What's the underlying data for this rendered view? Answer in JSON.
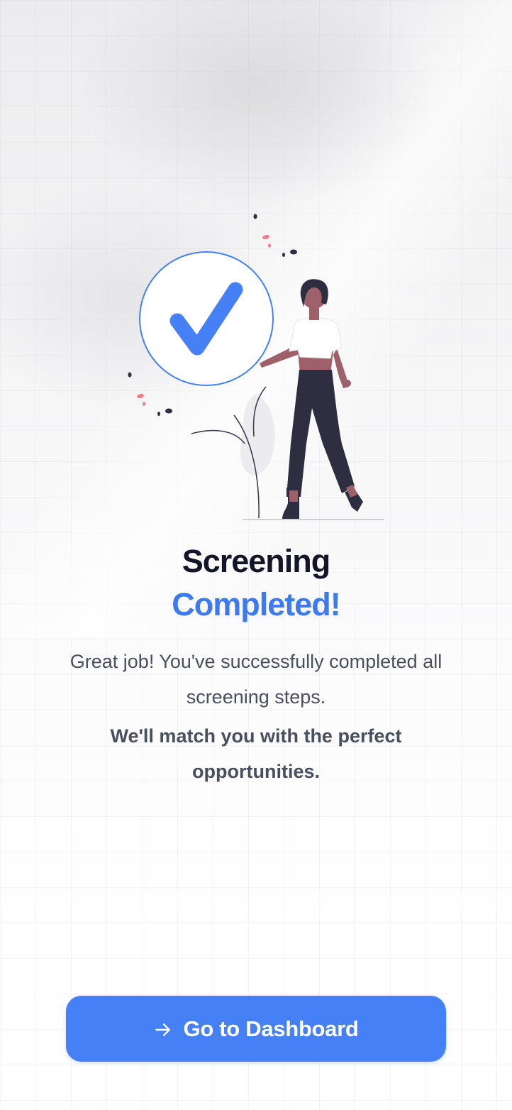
{
  "hero": {
    "title_line1": "Screening",
    "title_line2": "Completed!",
    "description": "Great job! You've successfully completed all screening steps.",
    "emphasis": "We'll match you with the perfect opportunities."
  },
  "cta": {
    "label": "Go to Dashboard",
    "icon": "arrow-right-icon"
  },
  "colors": {
    "accent": "#4580f7",
    "title": "#141627",
    "body_text": "#4a4f5e",
    "highlight_pink": "#f47e8c"
  },
  "illustration": {
    "icon": "checkmark-icon"
  }
}
